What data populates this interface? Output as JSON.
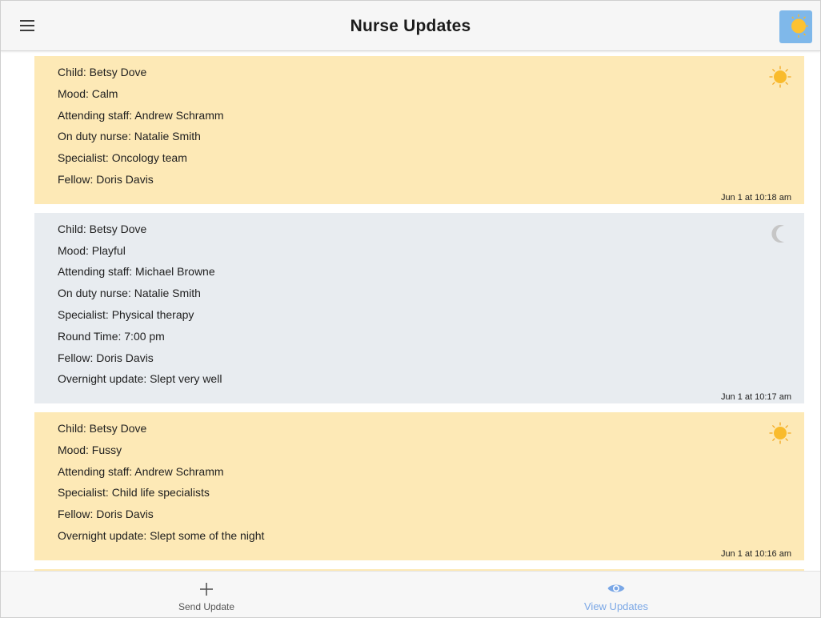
{
  "header": {
    "title": "Nurse Updates",
    "menu_icon": "hamburger-menu-icon",
    "mode_icon": "sun-moon-toggle-icon"
  },
  "updates": [
    {
      "theme": "day",
      "icon": "sun-icon",
      "lines": [
        "Child: Betsy Dove",
        "Mood: Calm",
        "Attending staff: Andrew Schramm",
        "On duty nurse: Natalie Smith",
        "Specialist: Oncology team",
        "Fellow: Doris Davis"
      ],
      "timestamp": "Jun 1 at 10:18 am"
    },
    {
      "theme": "night",
      "icon": "moon-icon",
      "lines": [
        "Child: Betsy Dove",
        "Mood: Playful",
        "Attending staff: Michael Browne",
        "On duty nurse: Natalie Smith",
        "Specialist: Physical therapy",
        "Round Time: 7:00 pm",
        "Fellow: Doris Davis",
        "Overnight update: Slept very well"
      ],
      "timestamp": "Jun 1 at 10:17 am"
    },
    {
      "theme": "day",
      "icon": "sun-icon",
      "lines": [
        "Child: Betsy Dove",
        "Mood: Fussy",
        "Attending staff: Andrew Schramm",
        "Specialist: Child life specialists",
        "Fellow: Doris Davis",
        "Overnight update: Slept some of the night"
      ],
      "timestamp": "Jun 1 at 10:16 am"
    }
  ],
  "bottom_nav": {
    "send_label": "Send Update",
    "send_icon": "plus-icon",
    "view_label": "View Updates",
    "view_icon": "eye-icon",
    "active": "view"
  },
  "colors": {
    "day_card": "#fde9b6",
    "night_card": "#e8ecf0",
    "accent_blue": "#7aa7e6",
    "sun": "#f7b928"
  }
}
